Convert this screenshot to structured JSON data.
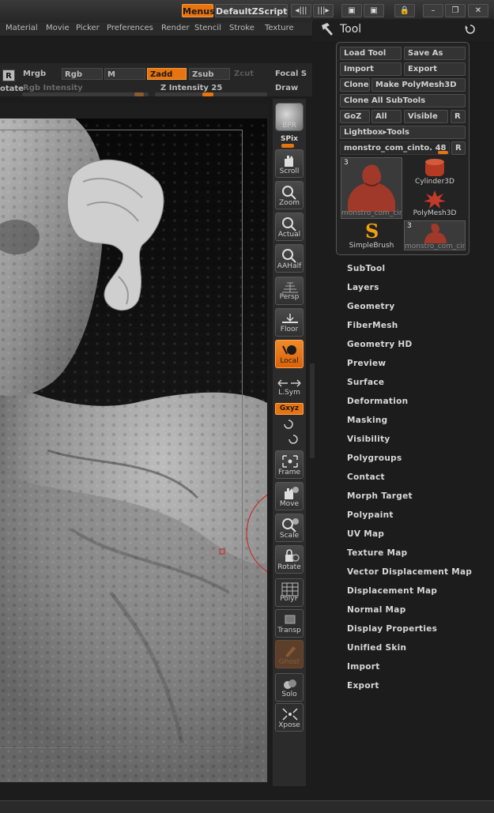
{
  "titlebar": {
    "menus_label": "Menus",
    "script_label": "DefaultZScript"
  },
  "menubar": {
    "items": [
      "Material",
      "Movie",
      "Picker",
      "Preferences",
      "Render",
      "Stencil",
      "Stroke",
      "Texture"
    ]
  },
  "drawbar": {
    "r_label": "R",
    "rotate_label": "otate",
    "mrgb": "Mrgb",
    "rgb": "Rgb",
    "m": "M",
    "zadd": "Zadd",
    "zsub": "Zsub",
    "zcut": "Zcut",
    "focal": "Focal S",
    "draw": "Draw",
    "rgb_intensity": "Rgb Intensity",
    "z_intensity": "Z Intensity 25",
    "z_intensity_value": 0.25
  },
  "tool": {
    "title": "Tool",
    "buttons": {
      "load_tool": "Load Tool",
      "save_as": "Save As",
      "import": "Import",
      "export": "Export",
      "clone": "Clone",
      "make_polymesh": "Make PolyMesh3D",
      "clone_all": "Clone All SubTools",
      "goz": "GoZ",
      "all": "All",
      "visible": "Visible",
      "r": "R",
      "lightbox": "Lightbox▸Tools",
      "current_tool": "monstro_com_cinto. 48",
      "r2": "R"
    },
    "thumbs": {
      "main_count": "3",
      "main_label": "monstro_com_cin",
      "cylinder": "Cylinder3D",
      "polymesh": "PolyMesh3D",
      "simplebrush": "SimpleBrush",
      "second_count": "3",
      "second_label": "monstro_com_cin"
    },
    "subpalettes": [
      "SubTool",
      "Layers",
      "Geometry",
      "FiberMesh",
      "Geometry HD",
      "Preview",
      "Surface",
      "Deformation",
      "Masking",
      "Visibility",
      "Polygroups",
      "Contact",
      "Morph Target",
      "Polypaint",
      "UV Map",
      "Texture Map",
      "Vector Displacement Map",
      "Displacement Map",
      "Normal Map",
      "Display Properties",
      "Unified Skin",
      "Import",
      "Export"
    ]
  },
  "shelf": {
    "bpr": "BPR",
    "spix": "SPix",
    "scroll": "Scroll",
    "zoom": "Zoom",
    "actual": "Actual",
    "aahalf": "AAHalf",
    "persp": "Persp",
    "floor": "Floor",
    "local": "Local",
    "lsym": "L.Sym",
    "xyz": "Gxyz",
    "frame": "Frame",
    "move": "Move",
    "scale": "Scale",
    "rotate": "Rotate",
    "polyf": "PolyF",
    "transp": "Transp",
    "ghost": "Ghost",
    "solo": "Solo",
    "xpose": "Xpose"
  }
}
